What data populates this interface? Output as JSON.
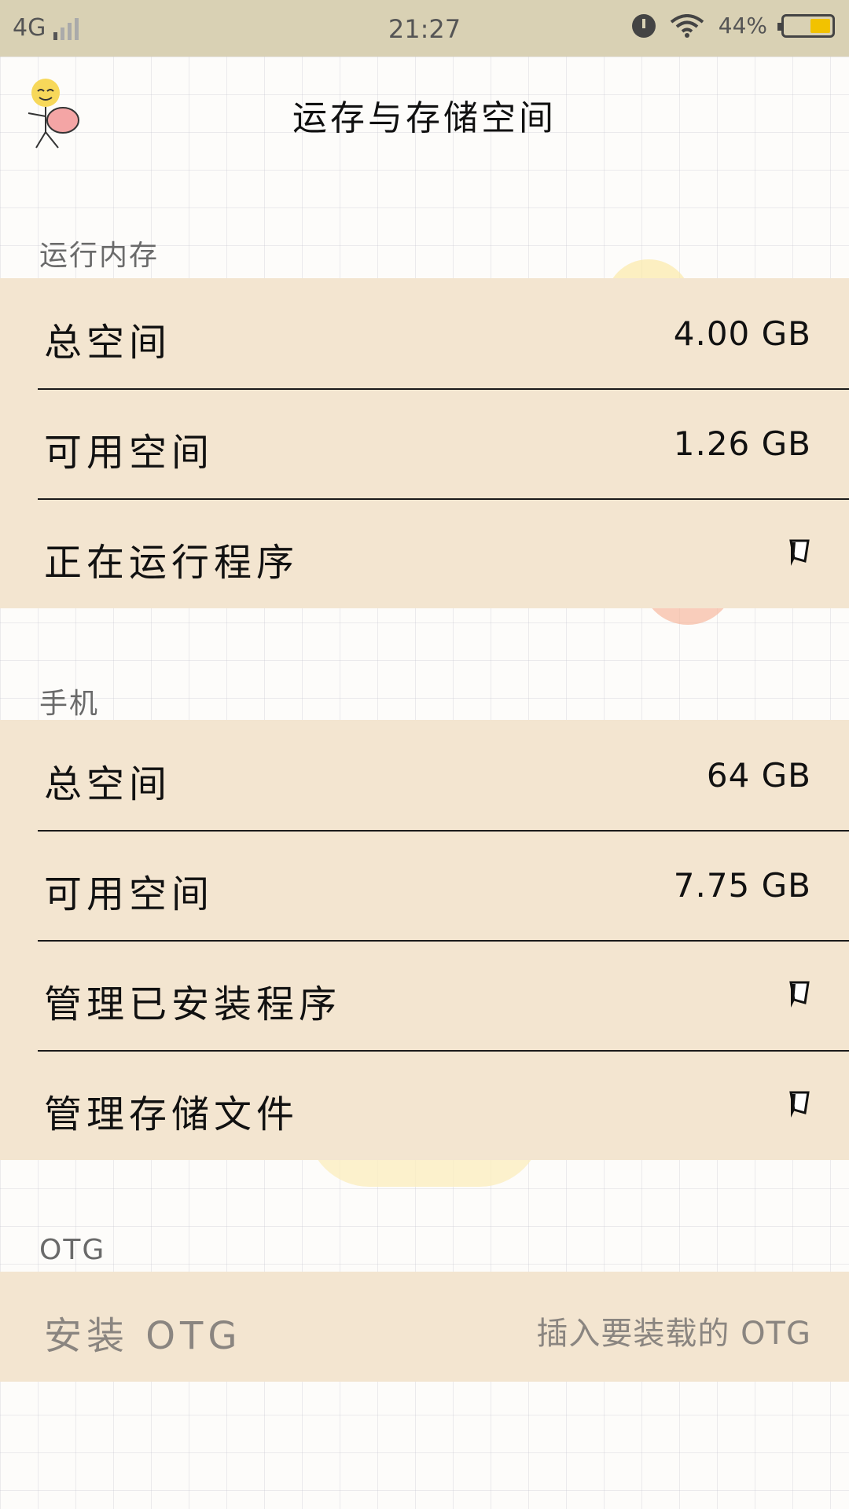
{
  "status_bar": {
    "network": "4G",
    "time": "21:27",
    "battery_percent": "44%",
    "battery_level": 0.44,
    "icons": [
      "signal-icon",
      "alarm-icon",
      "wifi-icon",
      "battery-icon"
    ]
  },
  "header": {
    "title": "运存与存储空间",
    "mascot_icon": "mascot-icon"
  },
  "ram": {
    "section_title": "运行内存",
    "rows": [
      {
        "label": "总空间",
        "value": "4.00 GB"
      },
      {
        "label": "可用空间",
        "value": "1.26 GB"
      },
      {
        "label": "正在运行程序",
        "icon": "flag-chevron-icon"
      }
    ]
  },
  "phone": {
    "section_title": "手机",
    "rows": [
      {
        "label": "总空间",
        "value": "64 GB"
      },
      {
        "label": "可用空间",
        "value": "7.75 GB"
      },
      {
        "label": "管理已安装程序",
        "icon": "flag-chevron-icon"
      },
      {
        "label": "管理存储文件",
        "icon": "flag-chevron-icon"
      }
    ]
  },
  "otg": {
    "section_title": "OTG",
    "rows": [
      {
        "label": "安装 OTG",
        "value": "插入要装载的 OTG"
      }
    ]
  },
  "colors": {
    "status_bar_bg": "#d9d1b4",
    "row_bg": "#f3e5d0",
    "divider": "#1a1a1a",
    "battery_fill": "#f2c200",
    "muted_text": "#8a8580"
  }
}
